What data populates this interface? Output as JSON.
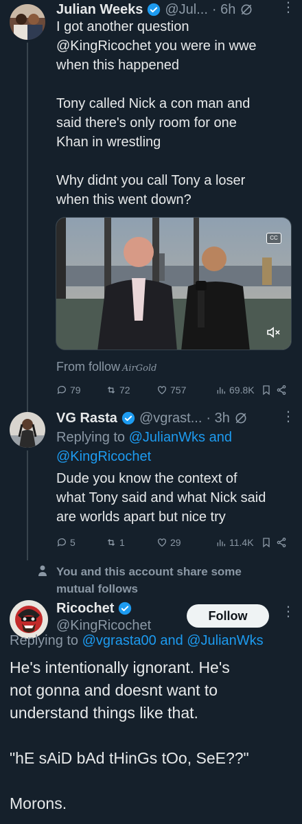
{
  "tweet1": {
    "display_name": "Julian Weeks",
    "handle": "@Jul...",
    "time": "· 6h",
    "text": "I got another question\n@KingRicochet you were in wwe\nwhen this happened\n\nTony called Nick a con man and\nsaid there's only room for one\nKhan in wrestling\n\nWhy didnt you call Tony a loser\nwhen this went down?",
    "video_source_prefix": "From follow",
    "video_source_script": "AirGold",
    "replies": "79",
    "reposts": "72",
    "likes": "757",
    "views": "69.8K"
  },
  "tweet2": {
    "display_name": "VG Rasta",
    "handle": "@vgrast...",
    "time": "· 3h",
    "replying_prefix": "Replying to ",
    "replying_users": "@JulianWks and\n@KingRicochet",
    "text": "Dude you know the context of\nwhat Tony said and what Nick said\nare worlds apart but nice try",
    "replies": "5",
    "reposts": "1",
    "likes": "29",
    "views": "11.4K"
  },
  "mutual_notice": "You and this account share some\nmutual follows",
  "tweet3": {
    "display_name": "Ricochet",
    "handle": "@KingRicochet",
    "follow_label": "Follow",
    "replying_prefix": "Replying to ",
    "replying_users": "@vgrasta00 and @JulianWks",
    "text": "He's intentionally ignorant. He's\nnot gonna and doesnt want to\nunderstand things like that.\n\n\"hE sAiD bAd tHinGs tOo, SeE??\"\n\nMorons."
  },
  "colors": {
    "background": "#15202b",
    "accent": "#1d9bf0",
    "muted": "#8b98a5"
  }
}
